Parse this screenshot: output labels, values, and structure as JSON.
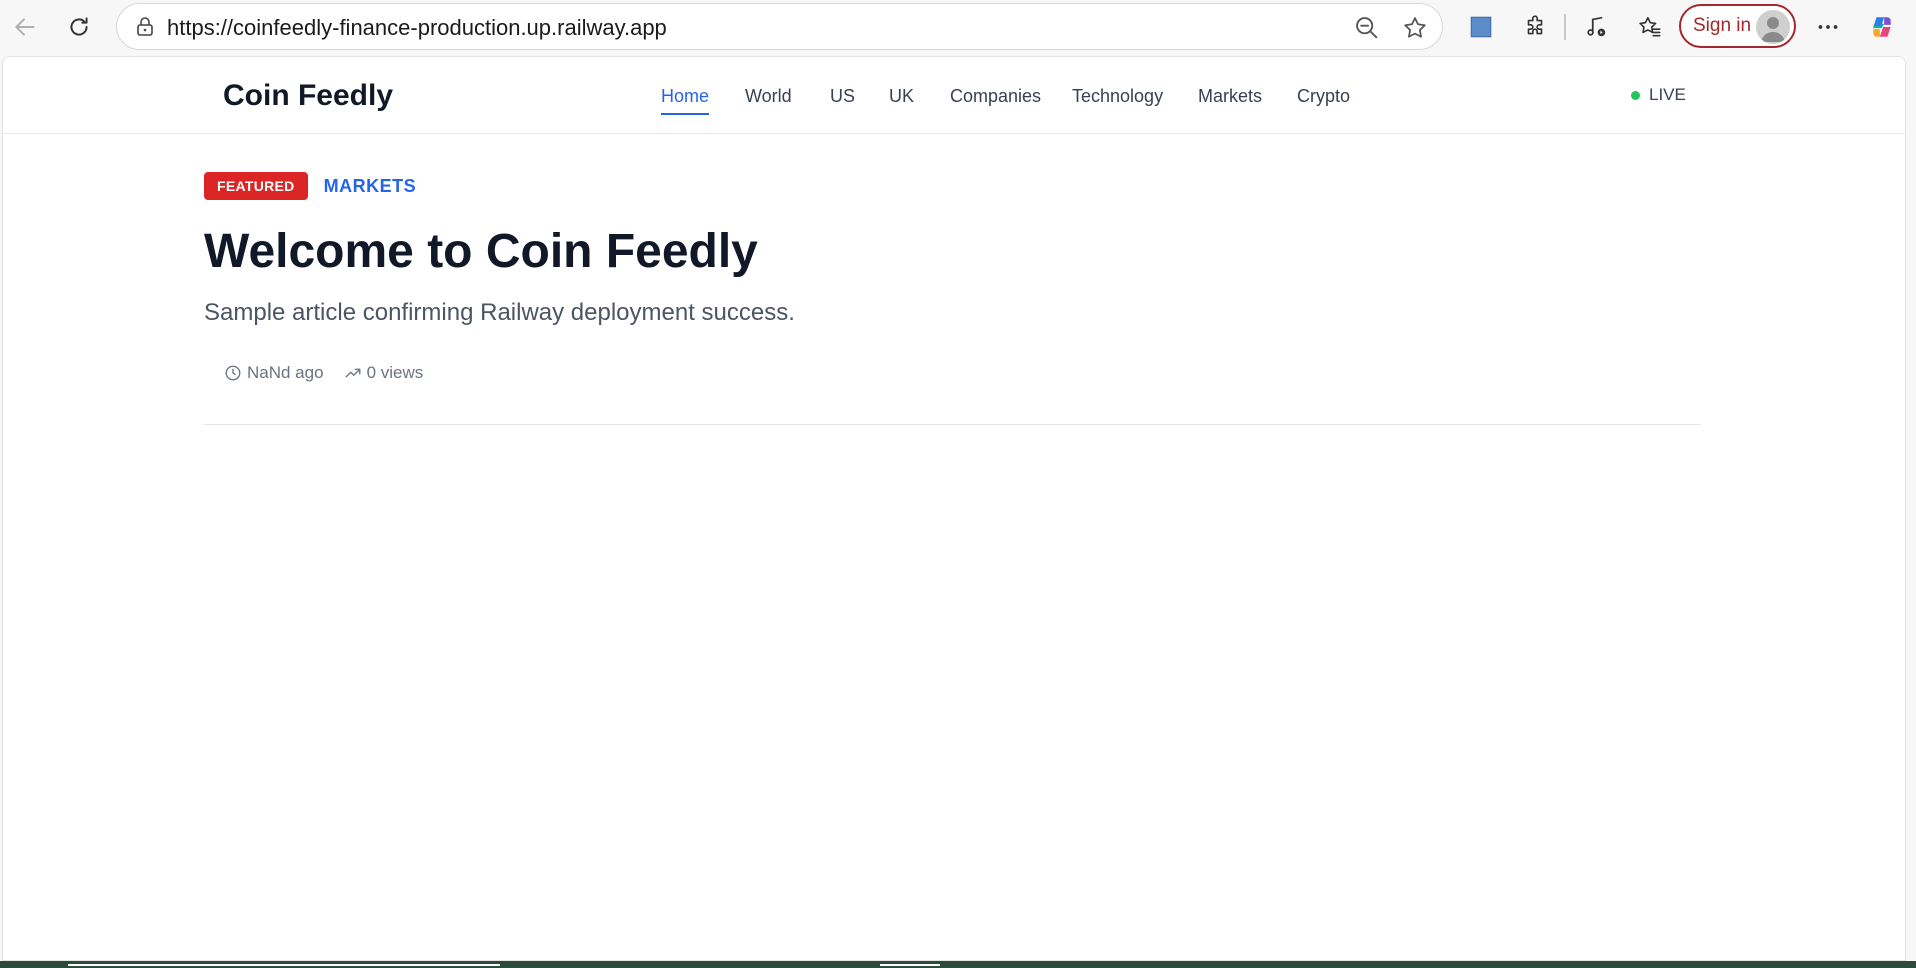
{
  "browser": {
    "url_prefix": "https://",
    "url_domain": "coinfeedly-finance-production.up.railway.app",
    "sign_in_label": "Sign in"
  },
  "site": {
    "logo": "Coin Feedly",
    "nav": [
      {
        "label": "Home",
        "active": true
      },
      {
        "label": "World"
      },
      {
        "label": "US"
      },
      {
        "label": "UK"
      },
      {
        "label": "Companies"
      },
      {
        "label": "Technology"
      },
      {
        "label": "Markets"
      },
      {
        "label": "Crypto"
      }
    ],
    "live_label": "LIVE"
  },
  "article": {
    "badge": "FEATURED",
    "category": "MARKETS",
    "title": "Welcome to Coin Feedly",
    "subtitle": "Sample article confirming Railway deployment success.",
    "time_ago": "NaNd ago",
    "views": "0 views"
  },
  "colors": {
    "accent": "#2563eb",
    "featured_red": "#dc2626",
    "live_green": "#22c55e",
    "signin_red": "#a3282c"
  }
}
